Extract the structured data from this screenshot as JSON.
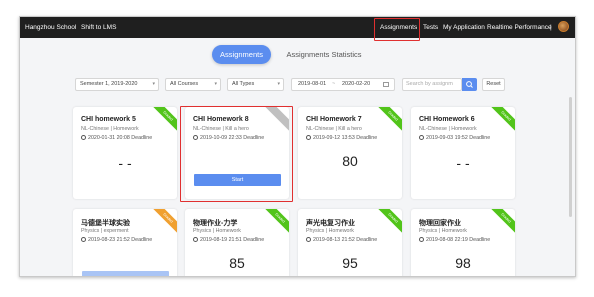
{
  "topbar": {
    "school": "Hangzhou School",
    "shift": "Shift to LMS",
    "nav": [
      "Assignments",
      "Tests",
      "My Application",
      "Realtime Performance"
    ],
    "separator": "|"
  },
  "tabs": {
    "active": "Assignments",
    "other": "Assignments Statistics"
  },
  "filters": {
    "semester": "Semester 1, 2019-2020",
    "courses": "All Courses",
    "types": "All Types",
    "date_from": "2019-08-01",
    "date_sep": "~",
    "date_to": "2020-02-20",
    "search_placeholder": "Search by assignm",
    "reset": "Reset"
  },
  "cards": [
    {
      "title": "CHI homework 5",
      "subject": "NL-Chinese | Homework",
      "deadline": "2020-01-31 20:08 Deadline",
      "score": "- -",
      "ribbon": "Graded",
      "ribbon_color": "#52c41a"
    },
    {
      "title": "CHI Homework 8",
      "subject": "NL-Chinese | Kill a hero",
      "deadline": "2019-10-09 22:33 Deadline",
      "score": "",
      "ribbon": "",
      "ribbon_color": "#c0c0c0",
      "button": "Start"
    },
    {
      "title": "CHI Homework 7",
      "subject": "NL-Chinese | Kill a hero",
      "deadline": "2019-09-12 13:53 Deadline",
      "score": "80",
      "ribbon": "Graded",
      "ribbon_color": "#52c41a"
    },
    {
      "title": "CHI Homework 6",
      "subject": "NL-Chinese | Homework",
      "deadline": "2019-09-03 19:52 Deadline",
      "score": "- -",
      "ribbon": "Graded",
      "ribbon_color": "#52c41a"
    },
    {
      "title": "马德堡半球实验",
      "subject": "Physics | experment",
      "deadline": "2019-08-23 21:52 Deadline",
      "score": "",
      "ribbon": "Graded",
      "ribbon_color": "#f0a030"
    },
    {
      "title": "物理作业-力学",
      "subject": "Physics | Homework",
      "deadline": "2019-08-19 21:51 Deadline",
      "score": "85",
      "ribbon": "Graded",
      "ribbon_color": "#52c41a"
    },
    {
      "title": "声光电复习作业",
      "subject": "Physics | Homework",
      "deadline": "2019-08-13 21:52 Deadline",
      "score": "95",
      "ribbon": "Graded",
      "ribbon_color": "#52c41a"
    },
    {
      "title": "物理回家作业",
      "subject": "Physics | Homework",
      "deadline": "2019-08-08 22:19 Deadline",
      "score": "98",
      "ribbon": "Graded",
      "ribbon_color": "#52c41a"
    }
  ]
}
